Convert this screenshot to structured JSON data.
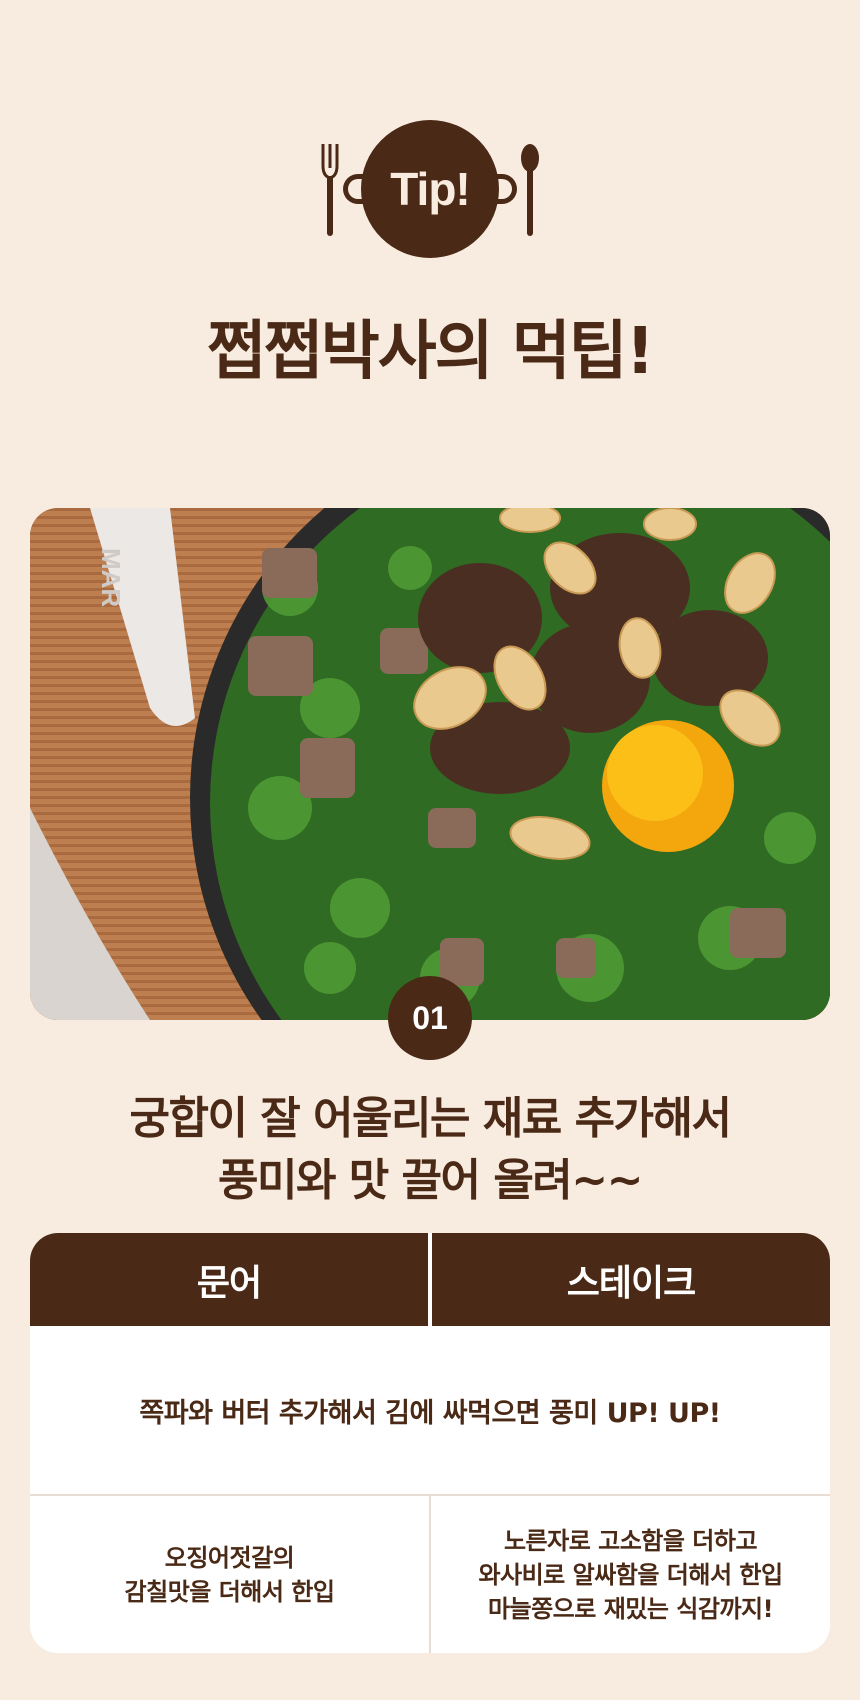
{
  "header": {
    "badge_text": "Tip!",
    "title": "쩝쩝박사의 먹팁!"
  },
  "tip": {
    "number": "01",
    "subtitle_line1": "궁합이 잘 어울리는 재료 추가해서",
    "subtitle_line2": "풍미와 맛 끌어 올려~~"
  },
  "photo": {
    "pan_text": "MAR"
  },
  "table": {
    "headers": [
      "문어",
      "스테이크"
    ],
    "shared_row": "쪽파와 버터 추가해서 김에 싸먹으면 풍미 UP! UP!",
    "col1_lines": [
      "오징어젓갈의",
      "감칠맛을 더해서 한입"
    ],
    "col2_lines": [
      "노른자로 고소함을 더하고",
      "와사비로 알싸함을 더해서 한입",
      "마늘쫑으로 재밌는 식감까지!"
    ]
  },
  "colors": {
    "background": "#f8ece1",
    "brown": "#4a2a16",
    "white": "#ffffff"
  }
}
